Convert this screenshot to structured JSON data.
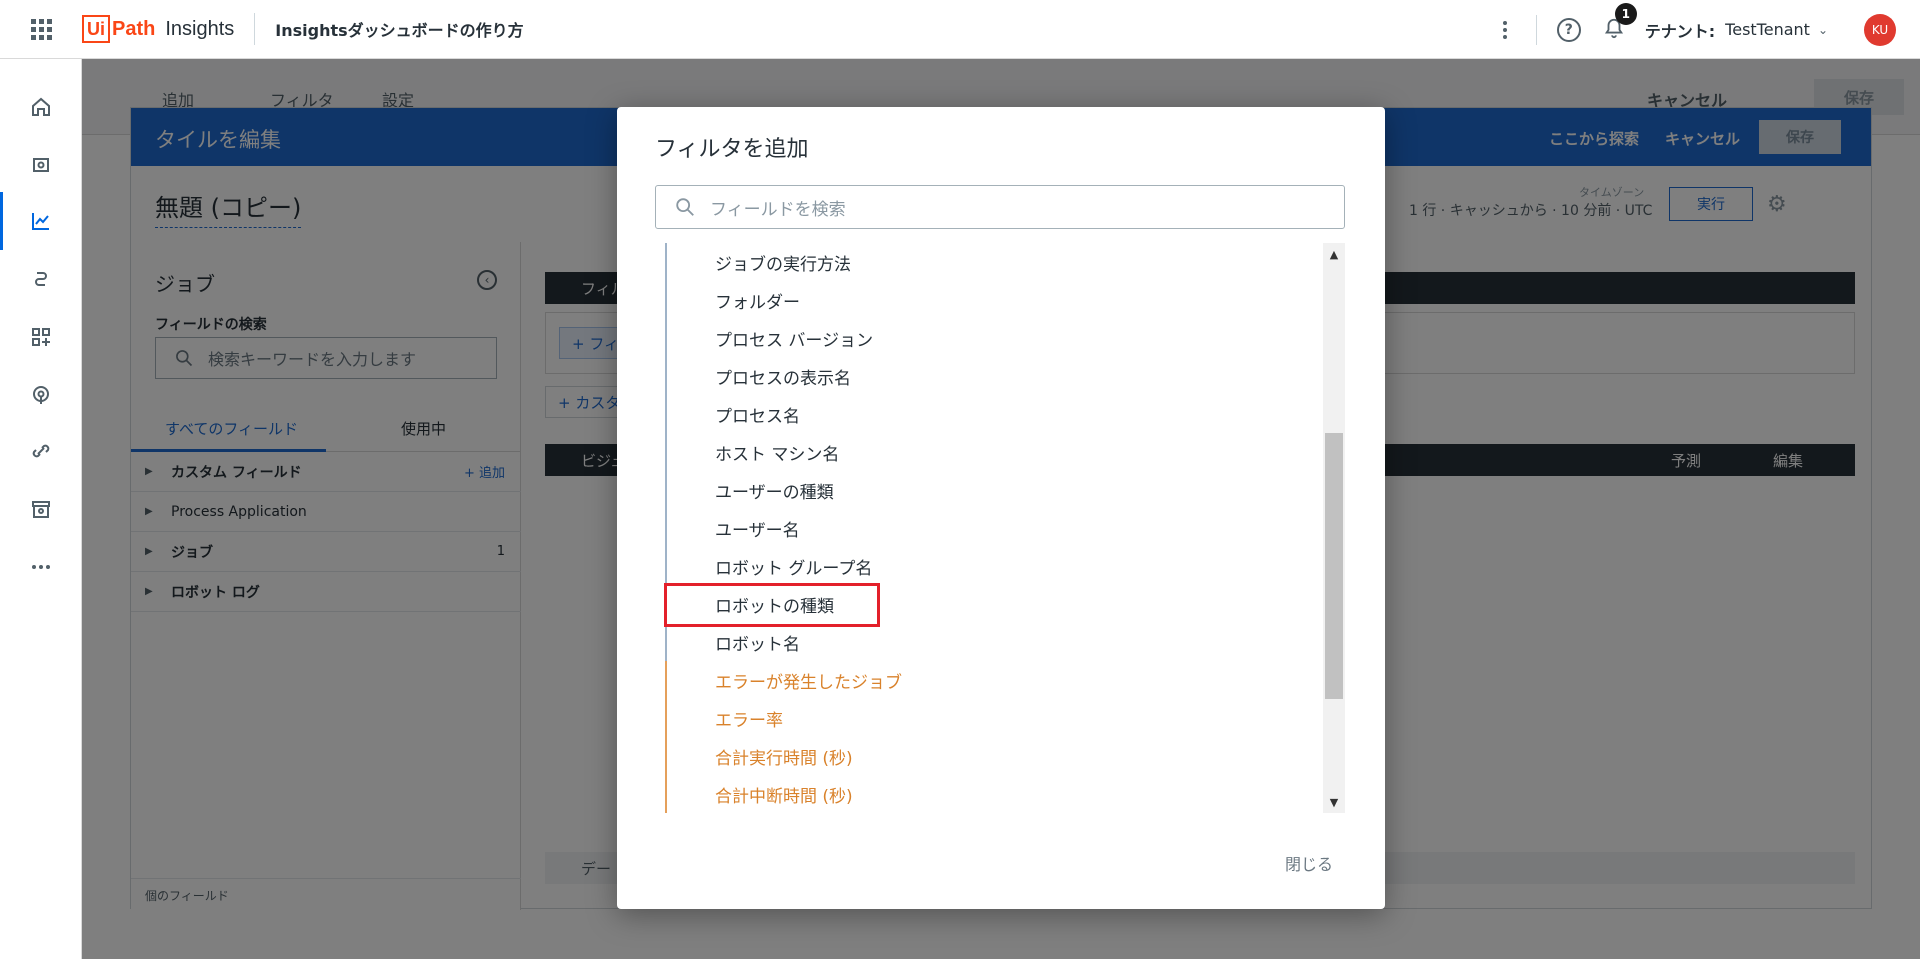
{
  "topbar": {
    "logo_ui": "Ui",
    "logo_path": "Path",
    "logo_product": "Insights",
    "dashboard_title": "Insightsダッシュボードの作り方",
    "notification_count": "1",
    "tenant_label": "テナント:",
    "tenant_value": "TestTenant",
    "avatar_initials": "KU"
  },
  "page_toolbar": {
    "add_label": "追加",
    "filter_label": "フィルタ",
    "settings_label": "設定",
    "cancel_label": "キャンセル",
    "save_label": "保存"
  },
  "edit_tile": {
    "title": "タイルを編集",
    "explore_label": "ここから探索",
    "cancel_label": "キャンセル",
    "save_label": "保存",
    "tile_name": "無題 (コピー)",
    "run_info": "1 行 · キャッシュから · 10 分前 · UTC",
    "timezone_label": "タイムゾーン",
    "run_label": "実行"
  },
  "field_panel": {
    "title": "ジョブ",
    "search_label": "フィールドの検索",
    "search_placeholder": "検索キーワードを入力します",
    "tab_all": "すべてのフィールド",
    "tab_in_use": "使用中",
    "rows": [
      {
        "label": "カスタム フィールド",
        "extra": "+ 追加"
      },
      {
        "label": "Process Application",
        "extra": ""
      },
      {
        "label": "ジョブ",
        "extra": "1"
      },
      {
        "label": "ロボット ログ",
        "extra": ""
      }
    ],
    "footer": "個のフィールド"
  },
  "main_area": {
    "filter_bar_label": "フィル",
    "add_filter_label": "+ フィ",
    "custom_label": "+ カスタ",
    "viz_bar_label": "ビジュ",
    "forecast_label": "予測",
    "edit_label": "編集",
    "data_bar_label": "デー"
  },
  "modal": {
    "title": "フィルタを追加",
    "search_placeholder": "フィールドを検索",
    "items": [
      {
        "label": "ジョブの実行方法",
        "kind": "dimension"
      },
      {
        "label": "フォルダー",
        "kind": "dimension"
      },
      {
        "label": "プロセス バージョン",
        "kind": "dimension"
      },
      {
        "label": "プロセスの表示名",
        "kind": "dimension"
      },
      {
        "label": "プロセス名",
        "kind": "dimension"
      },
      {
        "label": "ホスト マシン名",
        "kind": "dimension"
      },
      {
        "label": "ユーザーの種類",
        "kind": "dimension"
      },
      {
        "label": "ユーザー名",
        "kind": "dimension"
      },
      {
        "label": "ロボット グループ名",
        "kind": "dimension"
      },
      {
        "label": "ロボットの種類",
        "kind": "dimension"
      },
      {
        "label": "ロボット名",
        "kind": "dimension"
      },
      {
        "label": "エラーが発生したジョブ",
        "kind": "measure"
      },
      {
        "label": "エラー率",
        "kind": "measure"
      },
      {
        "label": "合計実行時間 (秒)",
        "kind": "measure"
      },
      {
        "label": "合計中断時間 (秒)",
        "kind": "measure"
      }
    ],
    "close_label": "閉じる",
    "highlighted_item": "ロボットの種類"
  },
  "colors": {
    "brand": "#fa4616",
    "primary": "#1e6bd1",
    "measure": "#d9822b",
    "highlight": "#e3202a"
  }
}
